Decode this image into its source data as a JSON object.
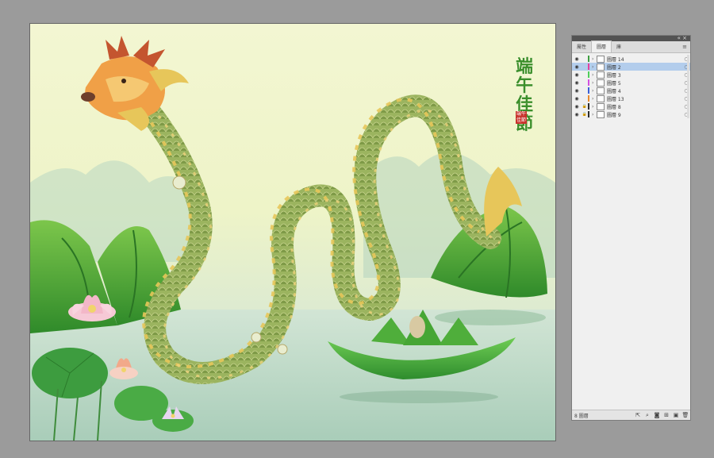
{
  "artwork": {
    "title_chars": [
      "端",
      "午",
      "佳",
      "節"
    ],
    "seal_text": [
      "端午",
      "佳節"
    ]
  },
  "panel": {
    "tabs": [
      {
        "label": "屬性",
        "active": false
      },
      {
        "label": "圖層",
        "active": true
      },
      {
        "label": "庫",
        "active": false
      }
    ],
    "menu_icon": "menu-icon",
    "layers": [
      {
        "name": "圖層 14",
        "color": "#3d9e40",
        "locked": false,
        "selected": false
      },
      {
        "name": "圖層 2",
        "color": "#e23f9f",
        "locked": false,
        "selected": true
      },
      {
        "name": "圖層 3",
        "color": "#4ecf5a",
        "locked": false,
        "selected": false
      },
      {
        "name": "圖層 5",
        "color": "#d34fe0",
        "locked": false,
        "selected": false
      },
      {
        "name": "圖層 4",
        "color": "#3a5fd8",
        "locked": false,
        "selected": false
      },
      {
        "name": "圖層 13",
        "color": "#e88a2e",
        "locked": false,
        "selected": false
      },
      {
        "name": "圖層 8",
        "color": "#2d2d2d",
        "locked": true,
        "selected": false
      },
      {
        "name": "圖層 9",
        "color": "#2d2d2d",
        "locked": true,
        "selected": false
      }
    ],
    "footer_count": "8 圖層",
    "footer_tools": [
      "export-icon",
      "search-icon",
      "clip-mask-icon",
      "sublayer-icon",
      "new-layer-icon",
      "delete-icon"
    ]
  },
  "colors": {
    "canvas_bg": "#9b9b9b",
    "dragon_scale": "#8aa452",
    "dragon_mane": "#e7c65a",
    "zongzi_green": "#3c9c34",
    "lotus_pink": "#f3b7c8",
    "title_green": "#3c8f2a",
    "seal_red": "#c8332c"
  }
}
